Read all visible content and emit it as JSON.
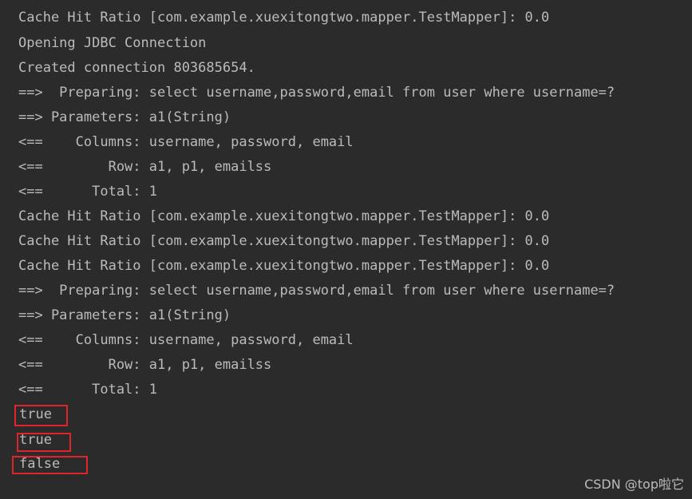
{
  "console": {
    "lines": [
      "Cache Hit Ratio [com.example.xuexitongtwo.mapper.TestMapper]: 0.0",
      "Opening JDBC Connection",
      "Created connection 803685654.",
      "==>  Preparing: select username,password,email from user where username=?",
      "==> Parameters: a1(String)",
      "<==    Columns: username, password, email",
      "<==        Row: a1, p1, emailss",
      "<==      Total: 1",
      "Cache Hit Ratio [com.example.xuexitongtwo.mapper.TestMapper]: 0.0",
      "Cache Hit Ratio [com.example.xuexitongtwo.mapper.TestMapper]: 0.0",
      "Cache Hit Ratio [com.example.xuexitongtwo.mapper.TestMapper]: 0.0",
      "==>  Preparing: select username,password,email from user where username=?",
      "==> Parameters: a1(String)",
      "<==    Columns: username, password, email",
      "<==        Row: a1, p1, emailss",
      "<==      Total: 1"
    ],
    "results": [
      "true",
      "true",
      "false"
    ]
  },
  "watermark": "CSDN @top啦它",
  "colors": {
    "background": "#2b2b2b",
    "text": "#bbbbbb",
    "highlight": "#e0242b"
  }
}
